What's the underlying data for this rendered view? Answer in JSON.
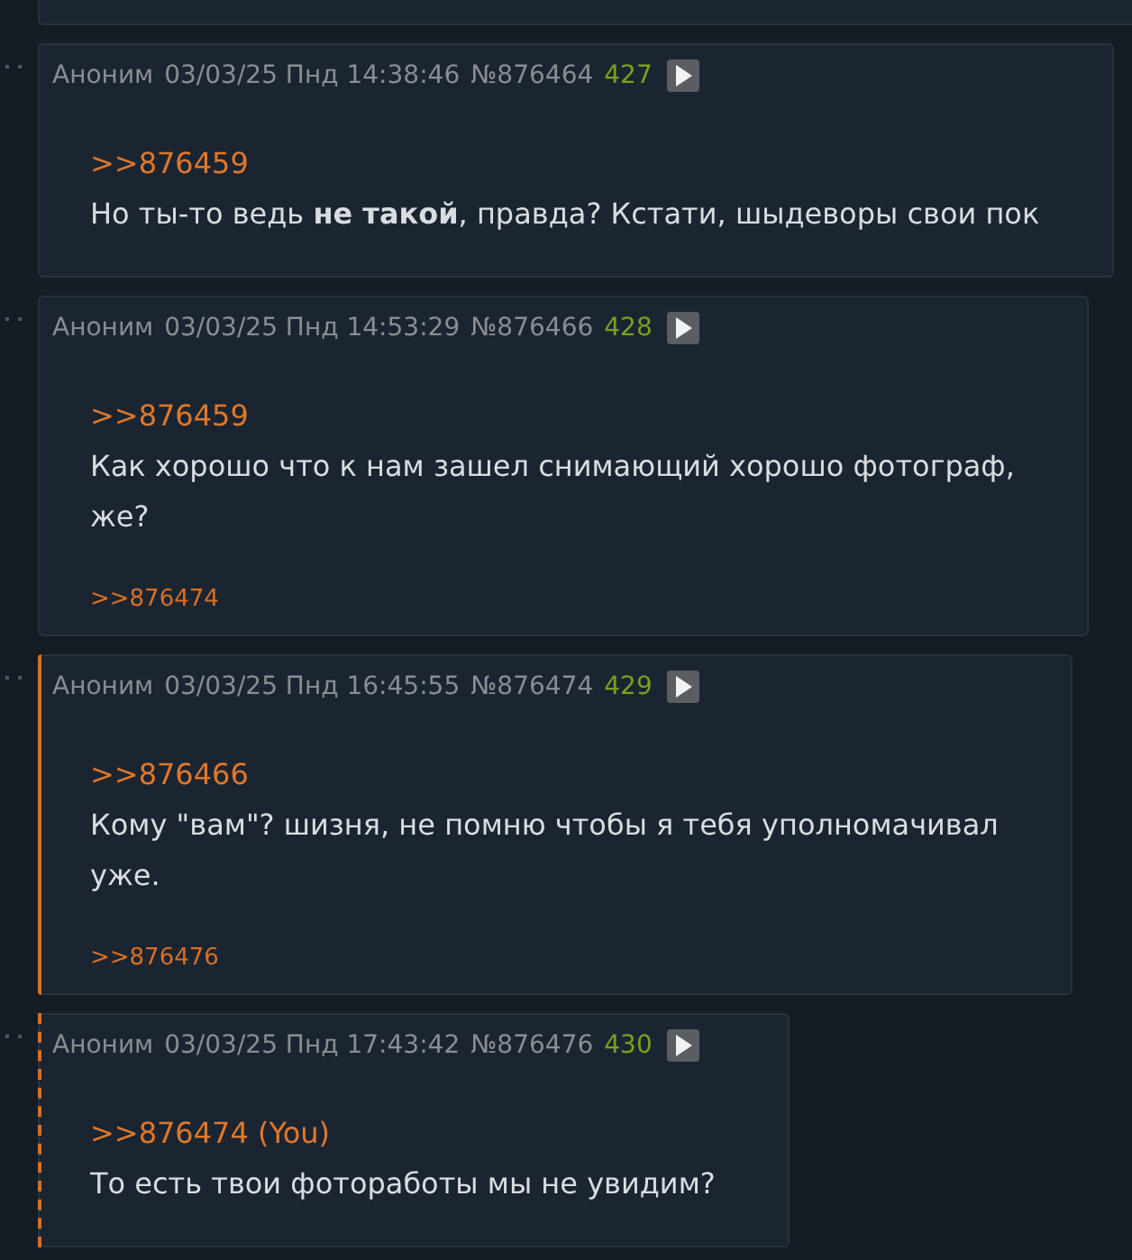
{
  "posts": [
    {
      "author": "Аноним",
      "datetime": "03/03/25 Пнд 14:38:46",
      "number": "№876464",
      "index": "427",
      "highlighted": false,
      "replies_to_you": false,
      "reply": ">>876459",
      "lines": [
        "Но ты-то ведь **не такой**, правда? Кстати, шыдеворы свои пок"
      ]
    },
    {
      "author": "Аноним",
      "datetime": "03/03/25 Пнд 14:53:29",
      "number": "№876466",
      "index": "428",
      "highlighted": false,
      "replies_to_you": false,
      "reply": ">>876459",
      "lines": [
        "Как хорошо что к нам зашел снимающий хорошо фотограф,",
        "же?"
      ],
      "backlinks": [
        ">>876474"
      ]
    },
    {
      "author": "Аноним",
      "datetime": "03/03/25 Пнд 16:45:55",
      "number": "№876474",
      "index": "429",
      "highlighted": true,
      "replies_to_you": false,
      "reply": ">>876466",
      "lines": [
        "Кому \"вам\"? шизня, не помню чтобы я тебя уполномачивал",
        "уже."
      ],
      "backlinks": [
        ">>876476"
      ]
    },
    {
      "author": "Аноним",
      "datetime": "03/03/25 Пнд 17:43:42",
      "number": "№876476",
      "index": "430",
      "highlighted": false,
      "replies_to_you": true,
      "reply": ">>876474 (You)",
      "lines": [
        "То есть твои фотоработы мы не увидим?"
      ]
    }
  ]
}
